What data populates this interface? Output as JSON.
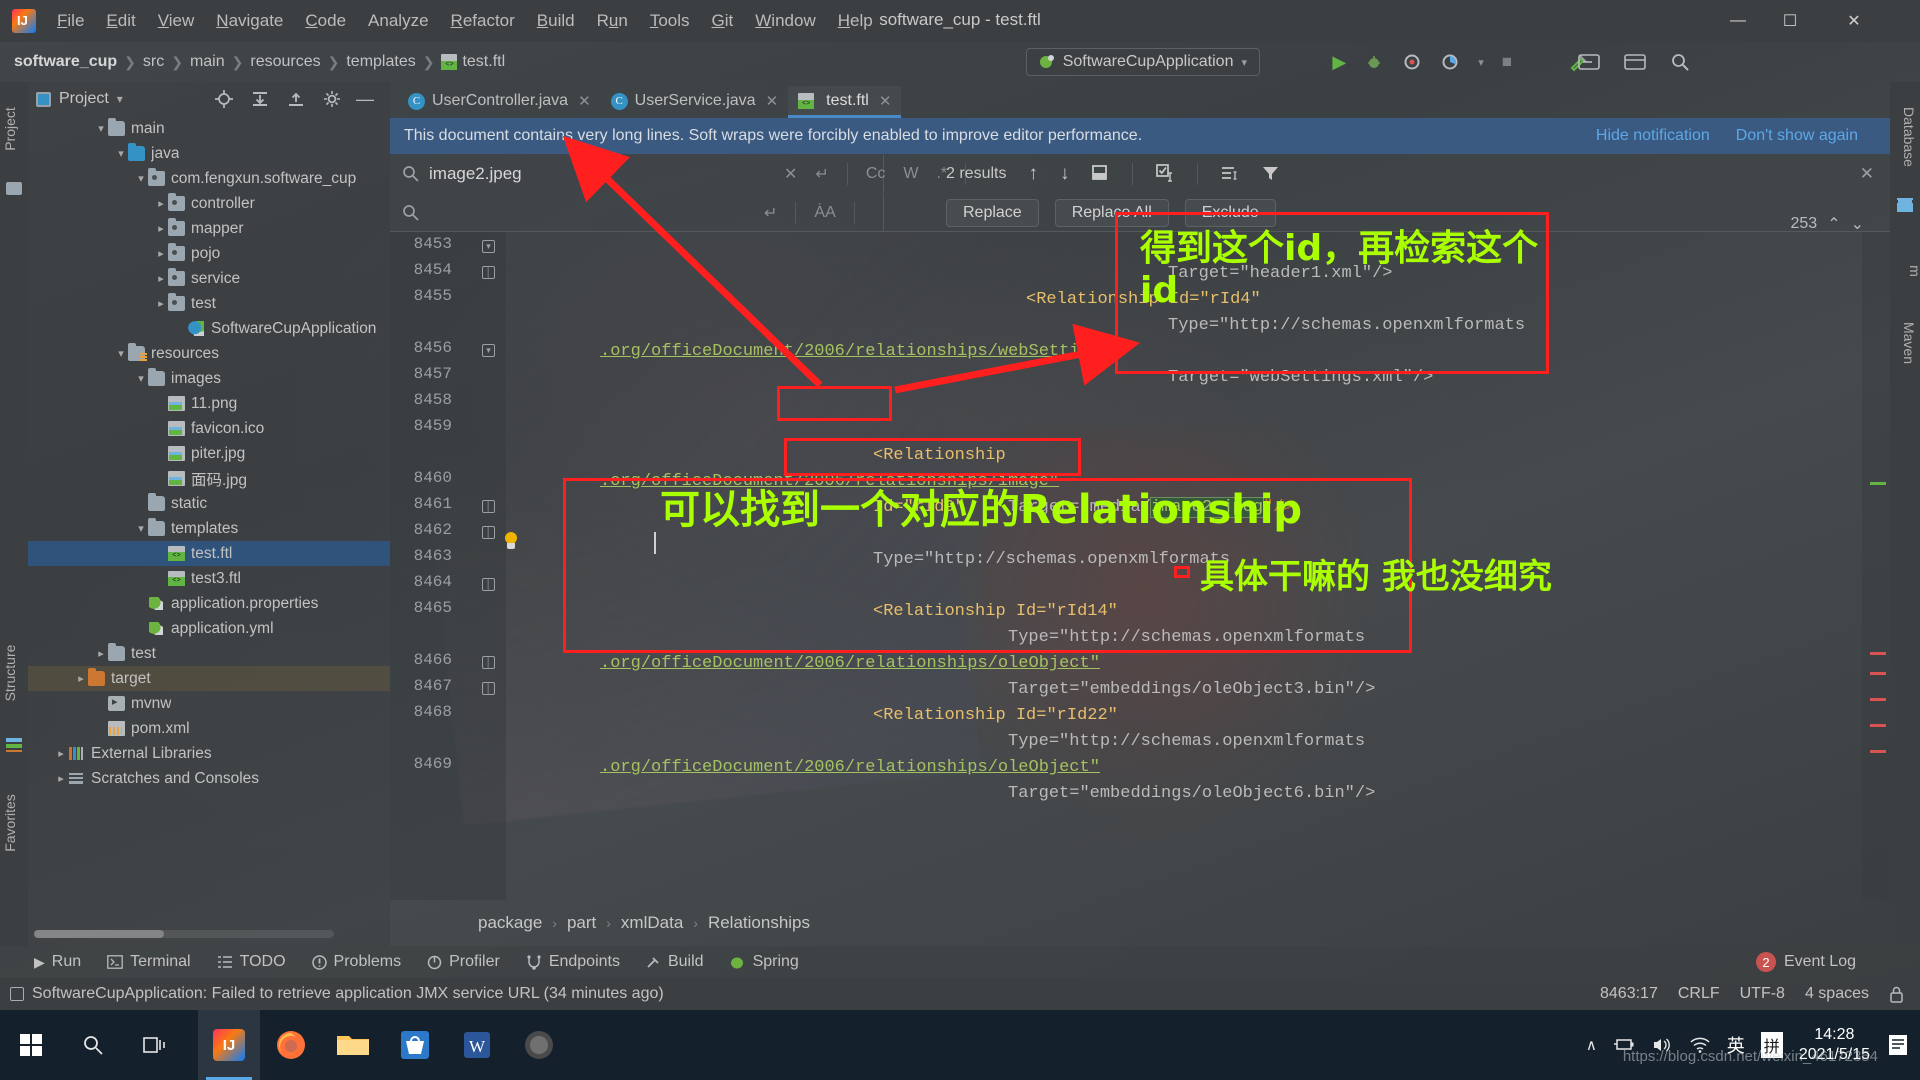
{
  "window": {
    "title": "software_cup - test.ftl",
    "minimize": "—",
    "maximize": "☐",
    "close": "✕"
  },
  "menu": {
    "items": [
      "File",
      "Edit",
      "View",
      "Navigate",
      "Code",
      "Analyze",
      "Refactor",
      "Build",
      "Run",
      "Tools",
      "Git",
      "Window",
      "Help"
    ]
  },
  "breadcrumb_top": {
    "items": [
      "software_cup",
      "src",
      "main",
      "resources",
      "templates",
      "test.ftl"
    ]
  },
  "toolbar": {
    "run_config": "SoftwareCupApplication",
    "build_icon": "hammer-icon",
    "run_icon": "▶",
    "debug_icon": "debug-icon",
    "coverage_icon": "coverage-icon",
    "profile_icon": "profile-icon",
    "stop_icon": "■",
    "search_icon": "⌕"
  },
  "left_strip": {
    "tabs": [
      "Project",
      "Structure",
      "Favorites"
    ]
  },
  "right_strip": {
    "tabs": [
      "Database",
      "m",
      "Maven"
    ]
  },
  "project_panel": {
    "title": "Project",
    "chevron": "▾",
    "actions": [
      "locate-icon",
      "expand-all-icon",
      "collapse-all-icon",
      "settings-icon",
      "hide-icon"
    ],
    "tree": [
      {
        "label": "main",
        "indent": 3,
        "arrow": "down",
        "icon": "folder",
        "state": "normal"
      },
      {
        "label": "java",
        "indent": 4,
        "arrow": "down",
        "icon": "folder-blue",
        "state": "normal"
      },
      {
        "label": "com.fengxun.software_cup",
        "indent": 5,
        "arrow": "down",
        "icon": "package",
        "state": "normal"
      },
      {
        "label": "controller",
        "indent": 6,
        "arrow": "right",
        "icon": "package",
        "state": "normal"
      },
      {
        "label": "mapper",
        "indent": 6,
        "arrow": "right",
        "icon": "package",
        "state": "normal"
      },
      {
        "label": "pojo",
        "indent": 6,
        "arrow": "right",
        "icon": "package",
        "state": "normal"
      },
      {
        "label": "service",
        "indent": 6,
        "arrow": "right",
        "icon": "package",
        "state": "normal"
      },
      {
        "label": "test",
        "indent": 6,
        "arrow": "right",
        "icon": "package",
        "state": "normal"
      },
      {
        "label": "SoftwareCupApplication",
        "indent": 7,
        "arrow": "none",
        "icon": "spring-app",
        "state": "normal"
      },
      {
        "label": "resources",
        "indent": 4,
        "arrow": "down",
        "icon": "folder-res",
        "state": "normal"
      },
      {
        "label": "images",
        "indent": 5,
        "arrow": "down",
        "icon": "folder",
        "state": "normal"
      },
      {
        "label": "11.png",
        "indent": 6,
        "arrow": "none",
        "icon": "image",
        "state": "normal"
      },
      {
        "label": "favicon.ico",
        "indent": 6,
        "arrow": "none",
        "icon": "image",
        "state": "normal"
      },
      {
        "label": "piter.jpg",
        "indent": 6,
        "arrow": "none",
        "icon": "image",
        "state": "normal"
      },
      {
        "label": "面码.jpg",
        "indent": 6,
        "arrow": "none",
        "icon": "image",
        "state": "normal"
      },
      {
        "label": "static",
        "indent": 5,
        "arrow": "none",
        "icon": "folder",
        "state": "normal"
      },
      {
        "label": "templates",
        "indent": 5,
        "arrow": "down",
        "icon": "folder",
        "state": "normal"
      },
      {
        "label": "test.ftl",
        "indent": 6,
        "arrow": "none",
        "icon": "ftl",
        "state": "selected"
      },
      {
        "label": "test3.ftl",
        "indent": 6,
        "arrow": "none",
        "icon": "ftl",
        "state": "normal"
      },
      {
        "label": "application.properties",
        "indent": 5,
        "arrow": "none",
        "icon": "spring",
        "state": "normal"
      },
      {
        "label": "application.yml",
        "indent": 5,
        "arrow": "none",
        "icon": "spring",
        "state": "normal"
      },
      {
        "label": "test",
        "indent": 3,
        "arrow": "right",
        "icon": "folder",
        "state": "normal"
      },
      {
        "label": "target",
        "indent": 2,
        "arrow": "right",
        "icon": "folder-orange",
        "state": "highlighted"
      },
      {
        "label": "mvnw",
        "indent": 3,
        "arrow": "none",
        "icon": "mvn",
        "state": "normal"
      },
      {
        "label": "pom.xml",
        "indent": 3,
        "arrow": "none",
        "icon": "xml",
        "state": "normal"
      },
      {
        "label": "External Libraries",
        "indent": 1,
        "arrow": "right",
        "icon": "lib",
        "state": "normal"
      },
      {
        "label": "Scratches and Consoles",
        "indent": 1,
        "arrow": "right",
        "icon": "scratch",
        "state": "normal"
      }
    ]
  },
  "editor": {
    "tabs": [
      {
        "label": "UserController.java",
        "icon": "class-icon",
        "active": false
      },
      {
        "label": "UserService.java",
        "icon": "class-icon",
        "active": false
      },
      {
        "label": "test.ftl",
        "icon": "ftl-icon",
        "active": true
      }
    ],
    "tab_close": "✕",
    "notification": {
      "message": "This document contains very long lines. Soft wraps were forcibly enabled to improve editor performance.",
      "hide_link": "Hide notification",
      "dont_show_link": "Don't show again"
    },
    "find": {
      "search_value": "image2.jpeg",
      "replace_value": "",
      "clear_icon": "✕",
      "newline_icon": "↵",
      "match_case": "Cc",
      "words": "W",
      "regex": ".*",
      "preserve_case": "ȦA",
      "results_label": "2 results",
      "prev_icon": "↑",
      "next_icon": "↓",
      "select_all_icon": "select-all-icon",
      "in_selection_icon": "in-selection-icon",
      "filter_icon": "filter-icon",
      "scope_icon": "scope-icon",
      "close_icon": "✕",
      "buttons": [
        "Replace",
        "Replace All",
        "Exclude"
      ]
    },
    "lines": [
      {
        "num": "8453",
        "fold": "top"
      },
      {
        "num": "8454",
        "fold": "mid"
      },
      {
        "num": "8455",
        "fold": "none"
      },
      {
        "num": "8456",
        "fold": "top"
      },
      {
        "num": "8457",
        "fold": "none"
      },
      {
        "num": "8458",
        "fold": "none"
      },
      {
        "num": "8459",
        "fold": "none"
      },
      {
        "num": "8460",
        "fold": "none"
      },
      {
        "num": "8461",
        "fold": "mid"
      },
      {
        "num": "8462",
        "fold": "mid"
      },
      {
        "num": "8463",
        "fold": "none"
      },
      {
        "num": "8464",
        "fold": "mid"
      },
      {
        "num": "8465",
        "fold": "none"
      },
      {
        "num": "8466",
        "fold": "mid"
      },
      {
        "num": "8467",
        "fold": "mid"
      },
      {
        "num": "8468",
        "fold": "none"
      },
      {
        "num": "8469",
        "fold": "none"
      }
    ],
    "code_text": {
      "l1_target_header": "Target=\"header1.xml\"/>",
      "l2_rel_rid4": "<Relationship Id=\"rId4\"",
      "l3_type": "Type=\"http://schemas.openxmlformats",
      "l4_url_websettings": ".org/officeDocument/2006/relationships/webSettings\"",
      "l5_target_websettings": "Target=\"webSettings.xml\"/>",
      "l6_rel_open": "<Relationship",
      "l6_id_rid9": "Id=\"rId9\"",
      "l6_type": "Type=\"http://schemas.openxmlformats",
      "l7_url_image": ".org/officeDocument/2006/relationships/image\"",
      "l8_target_media_prefix": "Target=\"media/",
      "l8_match": "image2.jpeg",
      "l8_suffix": "\"/>",
      "l9_rel_rid14": "<Relationship Id=\"rId14\"",
      "l10_type": "Type=\"http://schemas.openxmlformats",
      "l11_url_oleobject": ".org/officeDocument/2006/relationships/oleObject\"",
      "l12_target_ole3": "Target=\"embeddings/oleObject3.bin\"/>",
      "l13_rel_rid22": "<Relationship Id=\"rId22\"",
      "l14_type": "Type=\"http://schemas.openxmlformats",
      "l15_url_oleobject": ".org/officeDocument/2006/relationships/oleObject\"",
      "l16_target_ole6": "Target=\"embeddings/oleObject6.bin\"/>"
    },
    "minimap_count": "253",
    "minimap_up": "⌃",
    "minimap_down": "⌄",
    "breadcrumbs": [
      "package",
      "part",
      "xmlData",
      "Relationships"
    ],
    "breadcrumb_sep": "›"
  },
  "annotations": [
    {
      "name": "note-get-this-id",
      "text": "得到这个id，再检索这个 id"
    },
    {
      "name": "note-found-relationship",
      "text": "可以找到一个对应的Relationship"
    },
    {
      "name": "note-not-researched",
      "text": "具体干嘛的 我也没细究"
    }
  ],
  "bottom_tools": {
    "items": [
      {
        "label": "Run",
        "icon": "▶"
      },
      {
        "label": "Terminal",
        "icon": "terminal-icon"
      },
      {
        "label": "TODO",
        "icon": "todo-icon"
      },
      {
        "label": "Problems",
        "icon": "problems-icon"
      },
      {
        "label": "Profiler",
        "icon": "profiler-icon"
      },
      {
        "label": "Endpoints",
        "icon": "endpoints-icon"
      },
      {
        "label": "Build",
        "icon": "build-icon"
      },
      {
        "label": "Spring",
        "icon": "spring-icon"
      }
    ],
    "event_log": {
      "label": "Event Log",
      "count": "2"
    }
  },
  "status_bar": {
    "message": "SoftwareCupApplication: Failed to retrieve application JMX service URL (34 minutes ago)",
    "caret": "8463:17",
    "line_separator": "CRLF",
    "encoding": "UTF-8",
    "indent": "4 spaces",
    "lock_icon": "lock-icon"
  },
  "taskbar": {
    "start_icon": "windows-icon",
    "search_icon": "⌕",
    "taskview_icon": "task-view-icon",
    "apps": [
      "intellij-idea",
      "firefox",
      "file-explorer",
      "store",
      "word",
      "unknown-app"
    ],
    "tray": {
      "expand_icon": "∧",
      "battery_icon": "battery-icon",
      "volume_icon": "volume-icon",
      "network_icon": "network-icon",
      "ime_lang": "英",
      "ime_mode": "拼",
      "notification_icon": "notification-icon"
    },
    "clock_time": "14:28",
    "clock_date": "2021/5/15"
  },
  "watermark": "https://blog.csdn.net/weixin_46172354"
}
